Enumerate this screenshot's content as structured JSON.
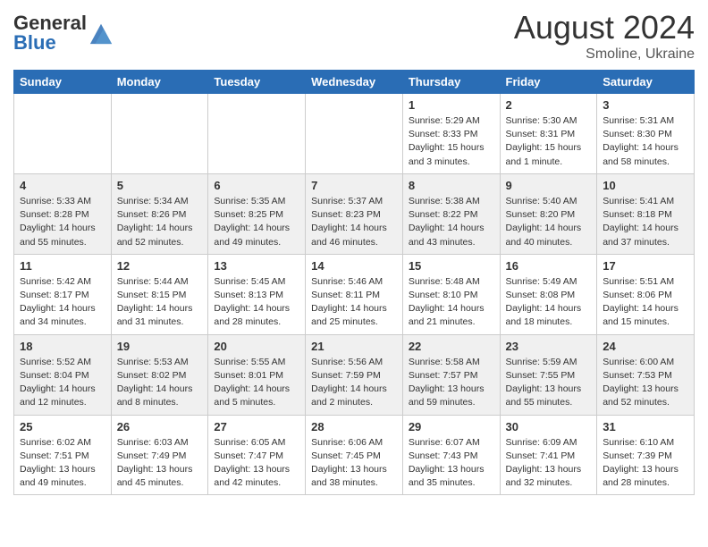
{
  "header": {
    "logo_general": "General",
    "logo_blue": "Blue",
    "month_year": "August 2024",
    "location": "Smoline, Ukraine"
  },
  "days_of_week": [
    "Sunday",
    "Monday",
    "Tuesday",
    "Wednesday",
    "Thursday",
    "Friday",
    "Saturday"
  ],
  "weeks": [
    [
      {
        "day": "",
        "info": ""
      },
      {
        "day": "",
        "info": ""
      },
      {
        "day": "",
        "info": ""
      },
      {
        "day": "",
        "info": ""
      },
      {
        "day": "1",
        "info": "Sunrise: 5:29 AM\nSunset: 8:33 PM\nDaylight: 15 hours\nand 3 minutes."
      },
      {
        "day": "2",
        "info": "Sunrise: 5:30 AM\nSunset: 8:31 PM\nDaylight: 15 hours\nand 1 minute."
      },
      {
        "day": "3",
        "info": "Sunrise: 5:31 AM\nSunset: 8:30 PM\nDaylight: 14 hours\nand 58 minutes."
      }
    ],
    [
      {
        "day": "4",
        "info": "Sunrise: 5:33 AM\nSunset: 8:28 PM\nDaylight: 14 hours\nand 55 minutes."
      },
      {
        "day": "5",
        "info": "Sunrise: 5:34 AM\nSunset: 8:26 PM\nDaylight: 14 hours\nand 52 minutes."
      },
      {
        "day": "6",
        "info": "Sunrise: 5:35 AM\nSunset: 8:25 PM\nDaylight: 14 hours\nand 49 minutes."
      },
      {
        "day": "7",
        "info": "Sunrise: 5:37 AM\nSunset: 8:23 PM\nDaylight: 14 hours\nand 46 minutes."
      },
      {
        "day": "8",
        "info": "Sunrise: 5:38 AM\nSunset: 8:22 PM\nDaylight: 14 hours\nand 43 minutes."
      },
      {
        "day": "9",
        "info": "Sunrise: 5:40 AM\nSunset: 8:20 PM\nDaylight: 14 hours\nand 40 minutes."
      },
      {
        "day": "10",
        "info": "Sunrise: 5:41 AM\nSunset: 8:18 PM\nDaylight: 14 hours\nand 37 minutes."
      }
    ],
    [
      {
        "day": "11",
        "info": "Sunrise: 5:42 AM\nSunset: 8:17 PM\nDaylight: 14 hours\nand 34 minutes."
      },
      {
        "day": "12",
        "info": "Sunrise: 5:44 AM\nSunset: 8:15 PM\nDaylight: 14 hours\nand 31 minutes."
      },
      {
        "day": "13",
        "info": "Sunrise: 5:45 AM\nSunset: 8:13 PM\nDaylight: 14 hours\nand 28 minutes."
      },
      {
        "day": "14",
        "info": "Sunrise: 5:46 AM\nSunset: 8:11 PM\nDaylight: 14 hours\nand 25 minutes."
      },
      {
        "day": "15",
        "info": "Sunrise: 5:48 AM\nSunset: 8:10 PM\nDaylight: 14 hours\nand 21 minutes."
      },
      {
        "day": "16",
        "info": "Sunrise: 5:49 AM\nSunset: 8:08 PM\nDaylight: 14 hours\nand 18 minutes."
      },
      {
        "day": "17",
        "info": "Sunrise: 5:51 AM\nSunset: 8:06 PM\nDaylight: 14 hours\nand 15 minutes."
      }
    ],
    [
      {
        "day": "18",
        "info": "Sunrise: 5:52 AM\nSunset: 8:04 PM\nDaylight: 14 hours\nand 12 minutes."
      },
      {
        "day": "19",
        "info": "Sunrise: 5:53 AM\nSunset: 8:02 PM\nDaylight: 14 hours\nand 8 minutes."
      },
      {
        "day": "20",
        "info": "Sunrise: 5:55 AM\nSunset: 8:01 PM\nDaylight: 14 hours\nand 5 minutes."
      },
      {
        "day": "21",
        "info": "Sunrise: 5:56 AM\nSunset: 7:59 PM\nDaylight: 14 hours\nand 2 minutes."
      },
      {
        "day": "22",
        "info": "Sunrise: 5:58 AM\nSunset: 7:57 PM\nDaylight: 13 hours\nand 59 minutes."
      },
      {
        "day": "23",
        "info": "Sunrise: 5:59 AM\nSunset: 7:55 PM\nDaylight: 13 hours\nand 55 minutes."
      },
      {
        "day": "24",
        "info": "Sunrise: 6:00 AM\nSunset: 7:53 PM\nDaylight: 13 hours\nand 52 minutes."
      }
    ],
    [
      {
        "day": "25",
        "info": "Sunrise: 6:02 AM\nSunset: 7:51 PM\nDaylight: 13 hours\nand 49 minutes."
      },
      {
        "day": "26",
        "info": "Sunrise: 6:03 AM\nSunset: 7:49 PM\nDaylight: 13 hours\nand 45 minutes."
      },
      {
        "day": "27",
        "info": "Sunrise: 6:05 AM\nSunset: 7:47 PM\nDaylight: 13 hours\nand 42 minutes."
      },
      {
        "day": "28",
        "info": "Sunrise: 6:06 AM\nSunset: 7:45 PM\nDaylight: 13 hours\nand 38 minutes."
      },
      {
        "day": "29",
        "info": "Sunrise: 6:07 AM\nSunset: 7:43 PM\nDaylight: 13 hours\nand 35 minutes."
      },
      {
        "day": "30",
        "info": "Sunrise: 6:09 AM\nSunset: 7:41 PM\nDaylight: 13 hours\nand 32 minutes."
      },
      {
        "day": "31",
        "info": "Sunrise: 6:10 AM\nSunset: 7:39 PM\nDaylight: 13 hours\nand 28 minutes."
      }
    ]
  ]
}
